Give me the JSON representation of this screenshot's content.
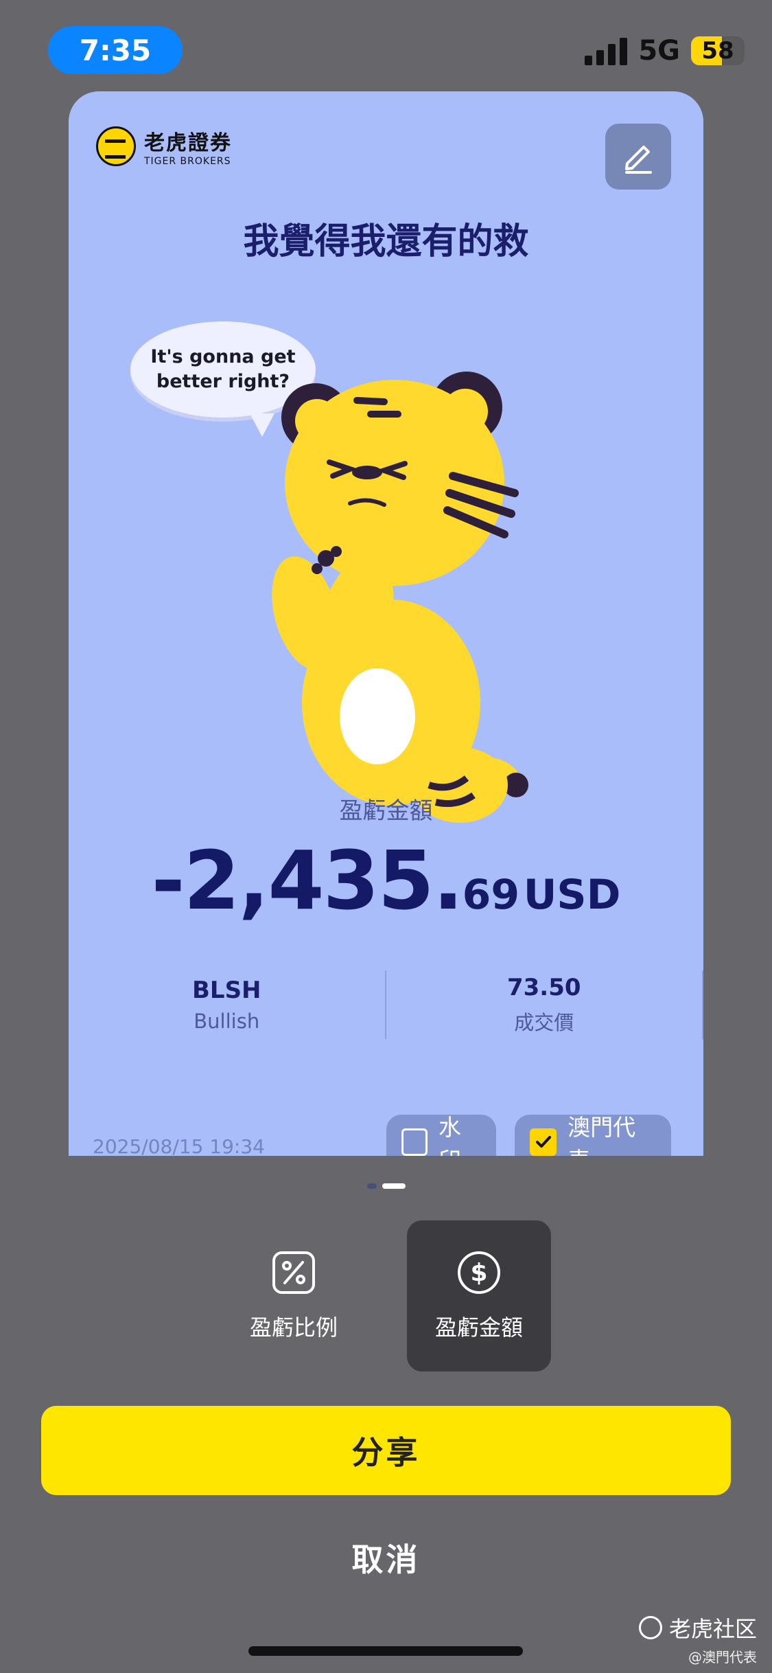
{
  "status_bar": {
    "time": "7:35",
    "network": "5G",
    "battery": "58"
  },
  "card": {
    "logo_cn": "老虎證券",
    "logo_en": "TIGER BROKERS",
    "title": "我覺得我還有的救",
    "bubble_line1": "It's gonna get",
    "bubble_line2": "better right?",
    "pl_label": "盈虧金額",
    "pl_main": "-2,435.",
    "pl_decimal": "69",
    "pl_currency": "USD",
    "stats": [
      {
        "value": "BLSH",
        "label": "Bullish"
      },
      {
        "value": "73.50",
        "label": "成交價"
      }
    ],
    "timestamp": "2025/08/15 19:34",
    "watermark_label": "水印",
    "macau_label": "澳門代表"
  },
  "modes": {
    "percent_label": "盈虧比例",
    "amount_label": "盈虧金額"
  },
  "actions": {
    "share": "分享",
    "cancel": "取消"
  },
  "footer": {
    "community": "老虎社区",
    "handle": "@澳門代表"
  },
  "colors": {
    "card_bg": "#aabdfb",
    "accent_yellow": "#ffe600",
    "loss_text": "#141a66"
  }
}
